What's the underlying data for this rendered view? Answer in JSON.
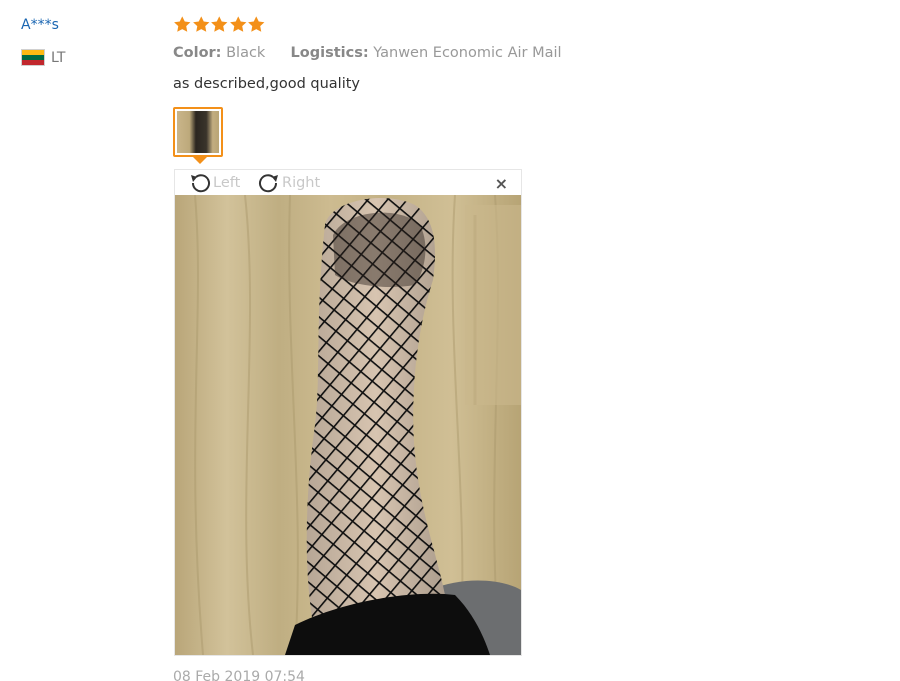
{
  "reviewer": {
    "name": "A***s",
    "country_code": "LT"
  },
  "review": {
    "rating": 5,
    "color_label": "Color:",
    "color_value": "Black",
    "logistics_label": "Logistics:",
    "logistics_value": "Yanwen Economic Air Mail",
    "text": "as described,good quality",
    "date": "08 Feb 2019 07:54"
  },
  "viewer": {
    "rotate_left_label": "Left",
    "rotate_right_label": "Right",
    "close_glyph": "×"
  },
  "colors": {
    "star": "#f39019",
    "accent": "#f39019",
    "username": "#1a66b2"
  },
  "icons": {
    "star": "star-icon",
    "flag": "lithuania-flag-icon",
    "rotate_left": "rotate-left-icon",
    "rotate_right": "rotate-right-icon",
    "close": "close-icon"
  }
}
